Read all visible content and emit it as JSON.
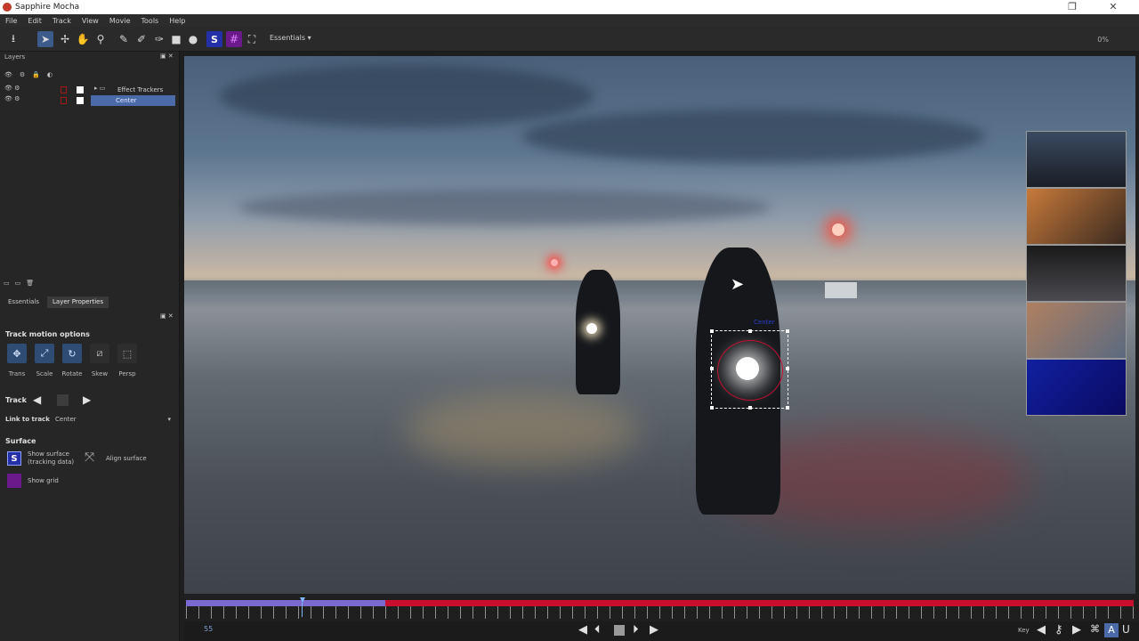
{
  "window": {
    "title": "Sapphire Mocha",
    "controls": [
      "❐",
      "✕"
    ]
  },
  "menu": [
    "File",
    "Edit",
    "Track",
    "View",
    "Movie",
    "Tools",
    "Help"
  ],
  "toolbar": {
    "workspace": "Essentials",
    "zoom": "0%"
  },
  "layers_panel": {
    "title": "Layers",
    "rows": [
      {
        "label": "Effect Trackers",
        "type": "group"
      },
      {
        "label": "Center",
        "type": "layer",
        "selected": true
      }
    ]
  },
  "tabs": [
    {
      "label": "Essentials",
      "active": false
    },
    {
      "label": "Layer Properties",
      "active": true
    }
  ],
  "properties": {
    "track_motion_title": "Track motion options",
    "motion_options": [
      {
        "label": "Trans",
        "active": true
      },
      {
        "label": "Scale",
        "active": true
      },
      {
        "label": "Rotate",
        "active": true
      },
      {
        "label": "Skew",
        "active": false
      },
      {
        "label": "Persp",
        "active": false
      }
    ],
    "track_label": "Track",
    "link_to_track_label": "Link to track",
    "link_to_track_value": "Center",
    "surface_title": "Surface",
    "show_surface_label": "Show surface",
    "show_surface_sub": "(tracking data)",
    "align_surface_label": "Align surface",
    "show_grid_label": "Show grid"
  },
  "viewer": {
    "track_label": "Center"
  },
  "timeline": {
    "current_frame": "55",
    "progress": 0.21,
    "key_label": "Key"
  },
  "colors": {
    "accent": "#4a6aa8",
    "timeline_range": "#c8102e",
    "surface_blue": "#2330a8",
    "grid_purple": "#6a1a8a"
  }
}
